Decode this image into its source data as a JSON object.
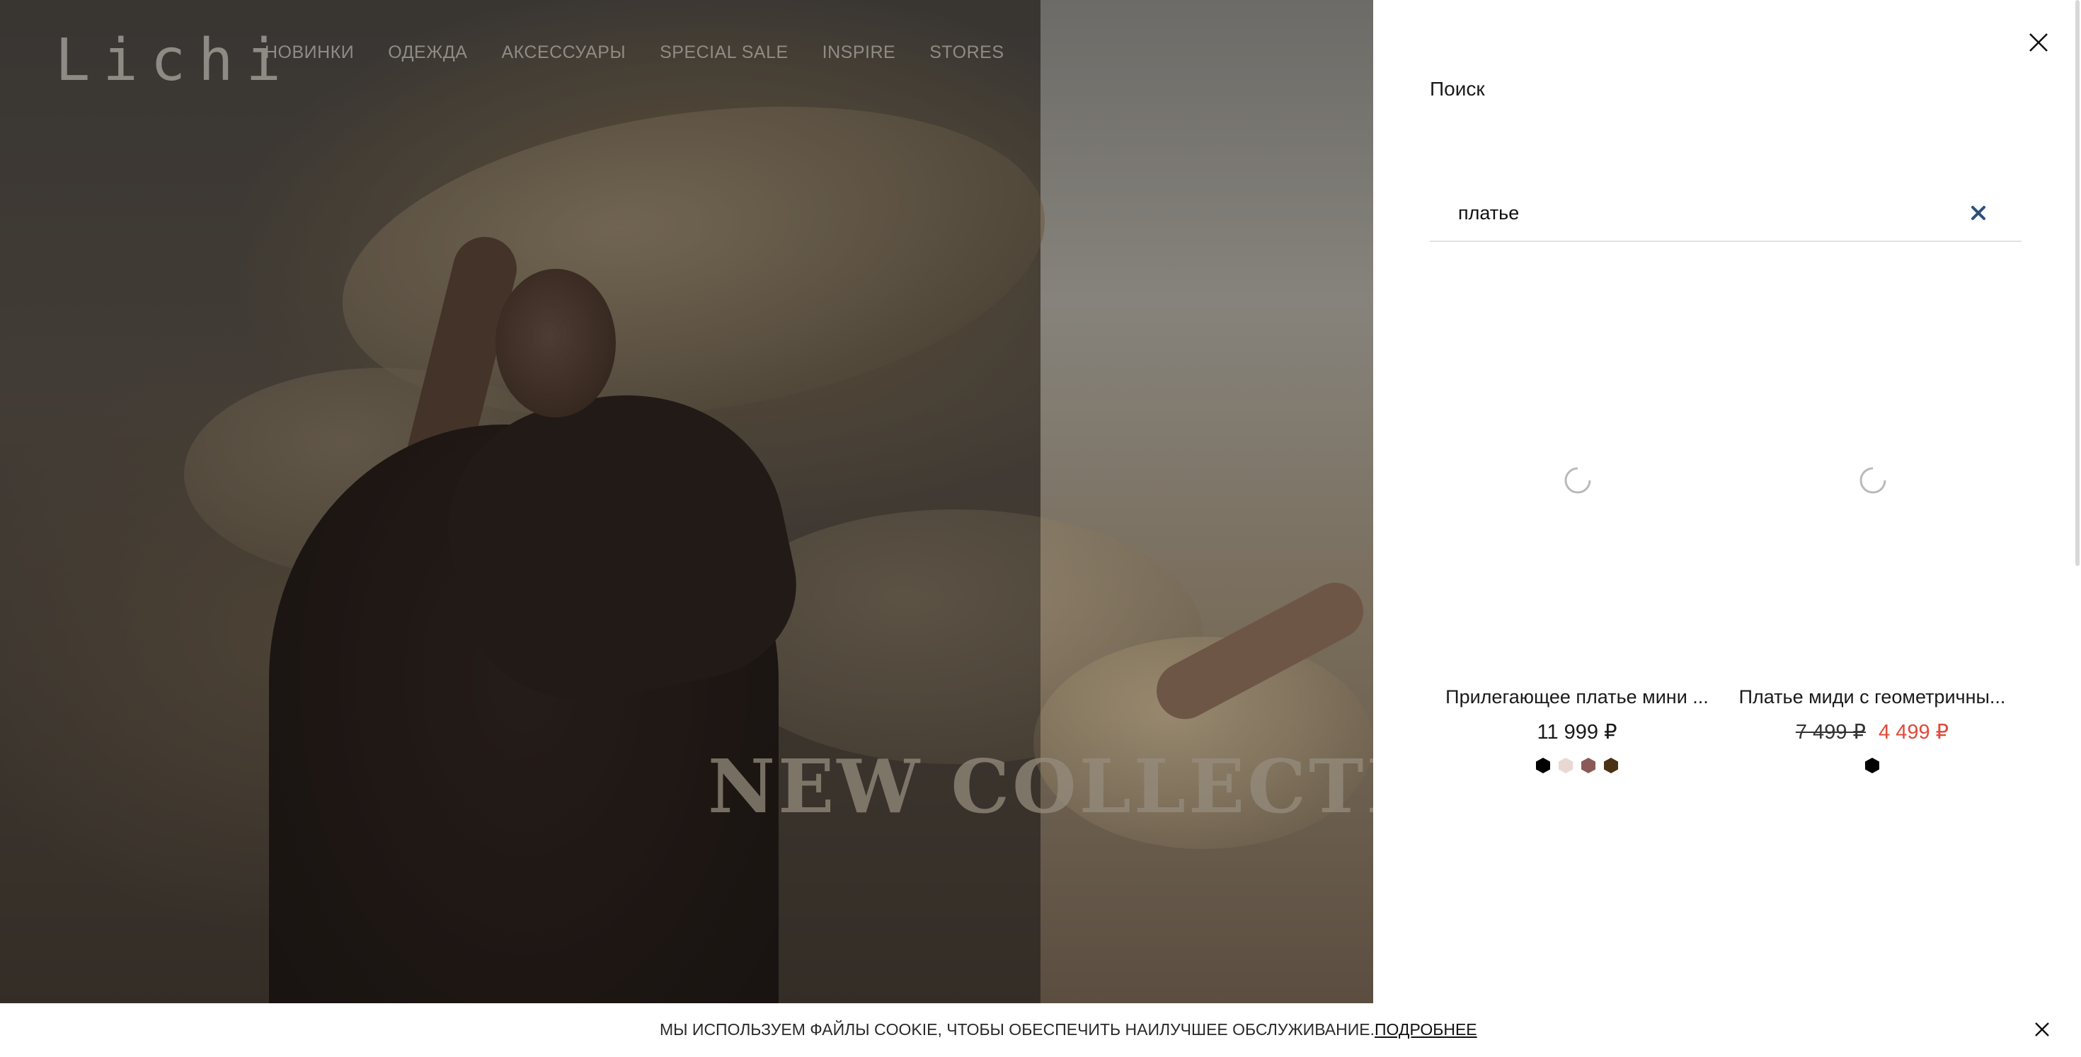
{
  "header": {
    "logo": "Lichi",
    "nav": [
      "НОВИНКИ",
      "ОДЕЖДА",
      "АКСЕССУАРЫ",
      "SPECIAL SALE",
      "INSPIRE",
      "STORES"
    ]
  },
  "hero": {
    "title": "NEW COLLECTION"
  },
  "search": {
    "title": "Поиск",
    "query": "платье",
    "results": [
      {
        "name": "Прилегающее платье мини ...",
        "price": "11 999 ₽",
        "swatches": [
          "#000000",
          "#e9d8d2",
          "#8a5a58",
          "#4a3216"
        ]
      },
      {
        "name": "Платье миди с геометричны...",
        "price_old": "7 499 ₽",
        "price_new": "4 499 ₽",
        "swatches": [
          "#000000"
        ]
      }
    ]
  },
  "cookie": {
    "text": "МЫ ИСПОЛЬЗУЕМ ФАЙЛЫ COOKIE, ЧТОБЫ ОБЕСПЕЧИТЬ НАИЛУЧШЕЕ ОБСЛУЖИВАНИЕ.",
    "link": "ПОДРОБНЕЕ"
  },
  "colors": {
    "sale_price": "#e04a3a",
    "clear_icon": "#2f4f7a"
  },
  "icons": {
    "panel_close": "close-icon",
    "search_clear": "clear-search-icon",
    "loading": "spinner-icon",
    "cookie_close": "close-icon"
  }
}
